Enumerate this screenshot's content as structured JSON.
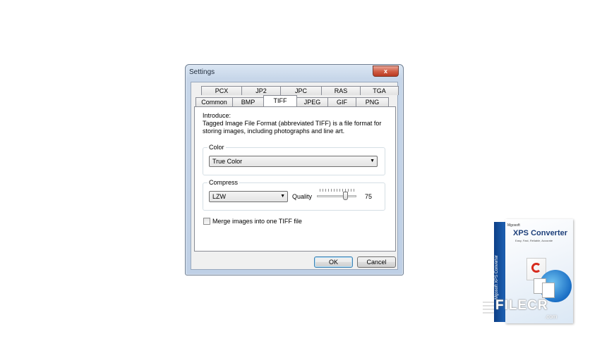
{
  "dialog": {
    "title": "Settings",
    "close_label": "x",
    "tabs_row1": [
      "PCX",
      "JP2",
      "JPC",
      "RAS",
      "TGA"
    ],
    "tabs_row2": [
      "Common",
      "BMP",
      "TIFF",
      "JPEG",
      "GIF",
      "PNG"
    ],
    "active_tab": "TIFF",
    "intro_label": "Introduce:",
    "intro_text": "Tagged Image File Format (abbreviated TIFF) is a file format for storing images, including photographs and line art.",
    "color_group": {
      "label": "Color",
      "selected": "True Color"
    },
    "compress_group": {
      "label": "Compress",
      "selected": "LZW",
      "quality_label": "Quality",
      "quality_value": "75",
      "quality_level": 0.75
    },
    "merge_checkbox": {
      "label": "Merge images into one TIFF file",
      "checked": false
    },
    "ok_label": "OK",
    "cancel_label": "Cancel"
  },
  "product_box": {
    "brand": "Mgosoft",
    "title": "XPS Converter",
    "tagline": "Easy, Fast, Reliable, Accurate",
    "spine_text": "Mgosoft XPS Converter"
  },
  "watermark": {
    "name": "FILECR",
    "sub": ".com"
  },
  "colors": {
    "title_bar": "#c7d6e9",
    "close_button": "#cf5a41",
    "box_blue": "#1f64b8"
  }
}
